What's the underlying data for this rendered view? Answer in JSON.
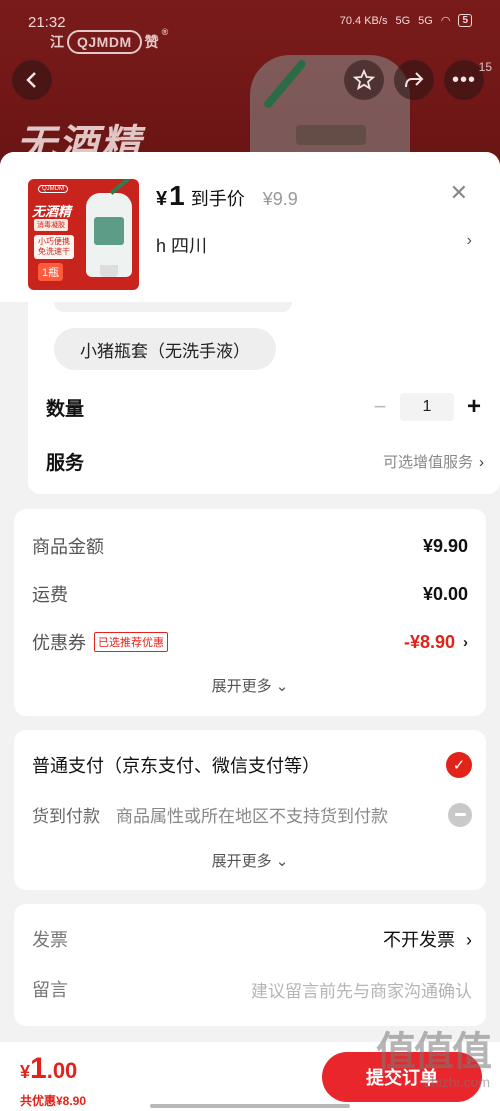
{
  "status_bar": {
    "time": "21:32",
    "network": "70.4 KB/s",
    "signal_1": "5G",
    "signal_2": "5G",
    "battery": "5"
  },
  "background": {
    "brand": "QJMDM",
    "brand_left": "江",
    "brand_right": "赞",
    "headline": "无酒精",
    "more_badge": "15"
  },
  "product": {
    "thumb": {
      "logo": "QJMDM",
      "line1": "无酒精",
      "line2": "消毒凝胶",
      "line3": "小巧便携 免洗速干",
      "line4": "1瓶"
    },
    "currency": "¥",
    "price_int": "1",
    "price_suffix": "到手价",
    "original_price": "¥9.9",
    "address": "h  四川"
  },
  "options": {
    "selected_variant": "小猪瓶套（无洗手液）",
    "quantity_label": "数量",
    "quantity_value": "1",
    "minus": "−",
    "plus": "+",
    "service_label": "服务",
    "service_value": "可选增值服务"
  },
  "costs": {
    "rows": [
      {
        "label": "商品金额",
        "value": "¥9.90"
      },
      {
        "label": "运费",
        "value": "¥0.00"
      }
    ],
    "coupon_label": "优惠券",
    "coupon_tag": "已选推荐优惠",
    "coupon_value": "-¥8.90",
    "expand_more": "展开更多"
  },
  "payment": {
    "primary": "普通支付（京东支付、微信支付等）",
    "cod_title": "货到付款",
    "cod_note": "商品属性或所在地区不支持货到付款",
    "expand_more": "展开更多"
  },
  "invoice": {
    "invoice_label": "发票",
    "invoice_value": "不开发票",
    "message_label": "留言",
    "message_placeholder": "建议留言前先与商家沟通确认"
  },
  "bottom_bar": {
    "currency": "¥",
    "total_int": "1",
    "total_dec": ".00",
    "saved": "共优惠¥8.90",
    "submit": "提交订单"
  },
  "watermark": {
    "title": "值值值",
    "domain": "zhizhi.com"
  },
  "colors": {
    "accent": "#e2231a",
    "background_page": "#f2f2f2"
  }
}
